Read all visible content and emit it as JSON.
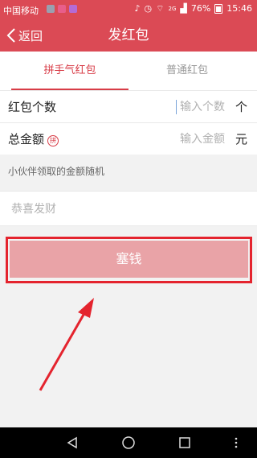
{
  "status_bar": {
    "carrier": "中国移动",
    "battery_level": "76%",
    "network": "2G",
    "time": "15:46",
    "notification_colors": [
      "#9aa0b0",
      "#e85e8a",
      "#b46bd6"
    ]
  },
  "nav": {
    "back_label": "返回",
    "title": "发红包"
  },
  "tabs": [
    {
      "label": "拼手气红包",
      "active": true
    },
    {
      "label": "普通红包",
      "active": false
    }
  ],
  "form": {
    "count": {
      "label": "红包个数",
      "placeholder": "输入个数",
      "unit": "个"
    },
    "amount": {
      "label": "总金额",
      "badge": "拼",
      "placeholder": "输入金额",
      "unit": "元"
    }
  },
  "hint": "小伙伴领取的金额随机",
  "greeting": {
    "placeholder": "恭喜发财"
  },
  "submit": {
    "label": "塞钱"
  },
  "colors": {
    "header": "#db4a55",
    "accent": "#d83c47",
    "button_disabled": "#e9a3a7",
    "annotation": "#e4242e"
  },
  "icons": {
    "back": "chevron-left-icon",
    "system_nav": [
      "back-triangle-icon",
      "home-circle-icon",
      "recents-square-icon",
      "menu-dots-icon"
    ]
  }
}
